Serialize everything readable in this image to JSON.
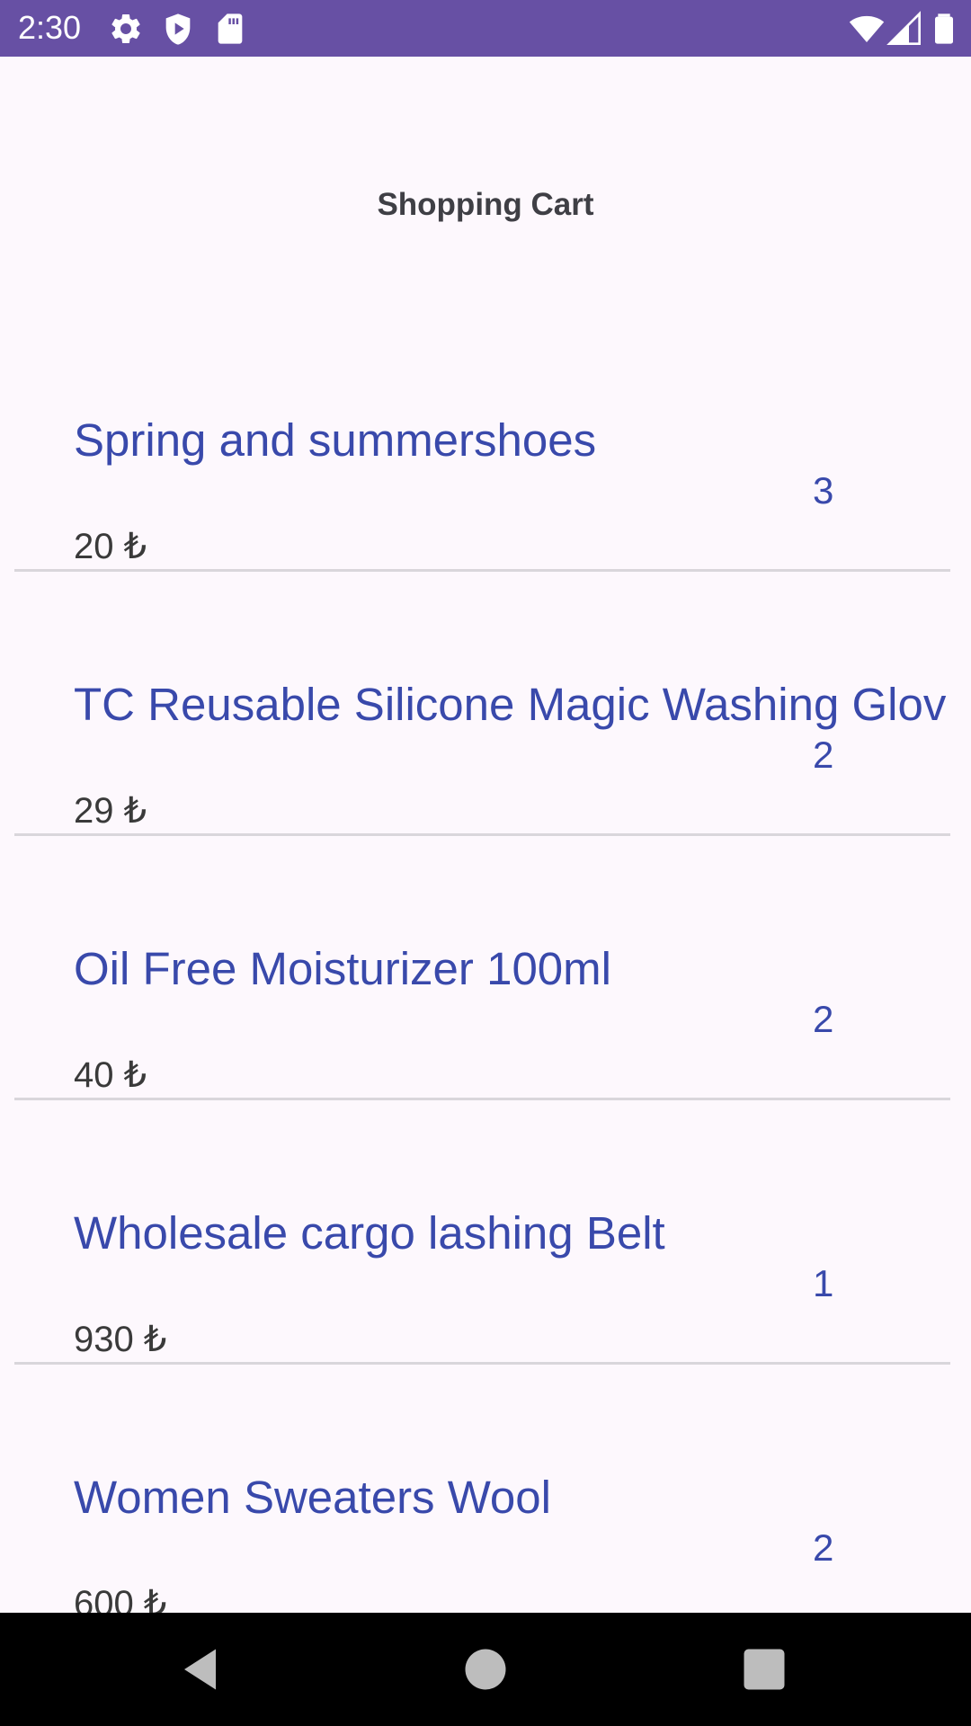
{
  "status_bar": {
    "time": "2:30",
    "background": "#6750a4",
    "left_icons": [
      "settings-gear-icon",
      "shield-play-icon",
      "sd-card-icon"
    ],
    "right_icons": [
      "wifi-icon",
      "cellular-signal-icon",
      "battery-icon"
    ]
  },
  "page": {
    "title": "Shopping Cart"
  },
  "cart": {
    "accent_color": "#3949ab",
    "items": [
      {
        "name": "Spring and summershoes",
        "price": "20 ₺",
        "quantity": "3"
      },
      {
        "name": "TC Reusable Silicone Magic Washing Glov",
        "price": "29 ₺",
        "quantity": "2"
      },
      {
        "name": "Oil Free Moisturizer 100ml",
        "price": "40 ₺",
        "quantity": "2"
      },
      {
        "name": "Wholesale cargo lashing Belt",
        "price": "930 ₺",
        "quantity": "1"
      },
      {
        "name": "Women Sweaters Wool",
        "price": "600 ₺",
        "quantity": "2"
      }
    ]
  },
  "nav_bar": {
    "buttons": [
      "back-triangle-icon",
      "home-circle-icon",
      "recents-square-icon"
    ]
  }
}
